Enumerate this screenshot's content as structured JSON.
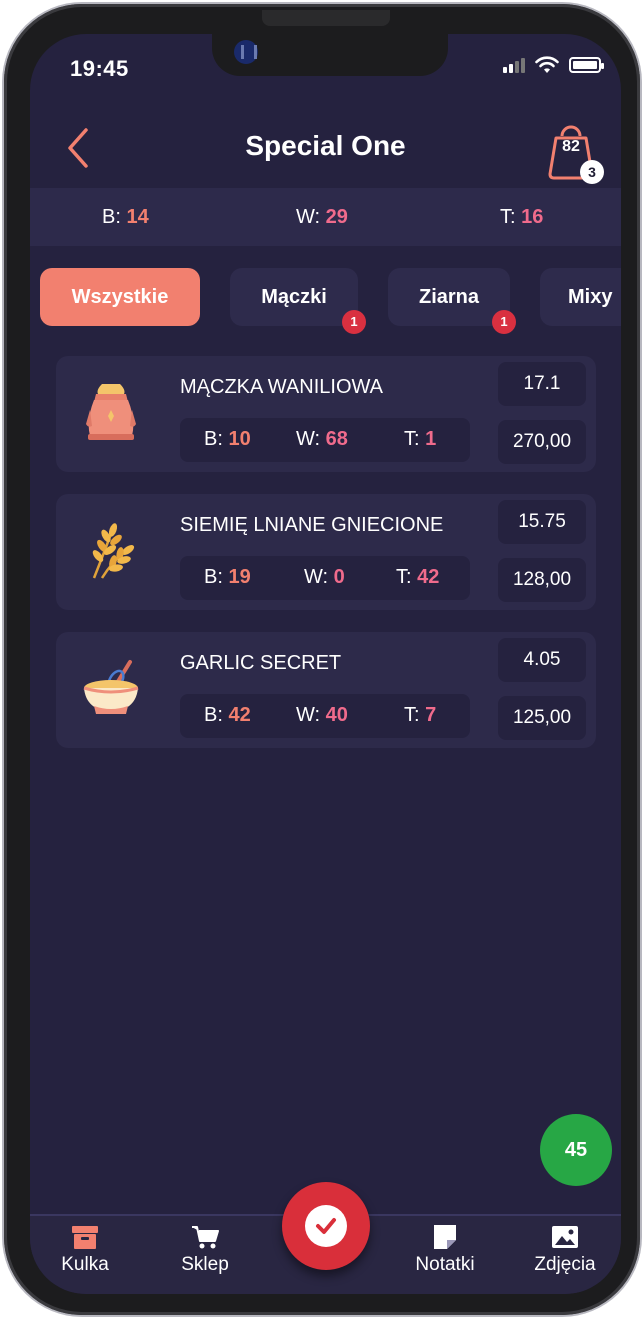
{
  "status_bar": {
    "time": "19:45"
  },
  "header": {
    "title": "Special One",
    "bag_count": "82",
    "bag_badge": "3"
  },
  "summary": {
    "b_label": "B:",
    "b_value": "14",
    "w_label": "W:",
    "w_value": "29",
    "t_label": "T:",
    "t_value": "16"
  },
  "tabs": [
    {
      "label": "Wszystkie",
      "badge": ""
    },
    {
      "label": "Mączki",
      "badge": "1"
    },
    {
      "label": "Ziarna",
      "badge": "1"
    },
    {
      "label": "Mixy",
      "badge": ""
    }
  ],
  "products": [
    {
      "name": "MĄCZKA WANILIOWA",
      "icon": "flour-sack-icon",
      "b": "10",
      "w": "68",
      "t": "1",
      "value_top": "17.1",
      "value_bottom": "270,00"
    },
    {
      "name": "SIEMIĘ LNIANE GNIECIONE",
      "icon": "wheat-icon",
      "b": "19",
      "w": "0",
      "t": "42",
      "value_top": "15.75",
      "value_bottom": "128,00"
    },
    {
      "name": "GARLIC SECRET",
      "icon": "mixing-bowl-icon",
      "b": "42",
      "w": "40",
      "t": "7",
      "value_top": "4.05",
      "value_bottom": "125,00"
    }
  ],
  "macro_labels": {
    "b": "B:",
    "w": "W:",
    "t": "T:"
  },
  "floating_count": "45",
  "bottom_nav": {
    "kulka": "Kulka",
    "sklep": "Sklep",
    "notatki": "Notatki",
    "zdjecia": "Zdjęcia"
  },
  "colors": {
    "background": "#25223f",
    "accent": "#f2806f",
    "pink": "#f06b8c",
    "confirm": "#d92f3a",
    "count_green": "#27a745"
  }
}
